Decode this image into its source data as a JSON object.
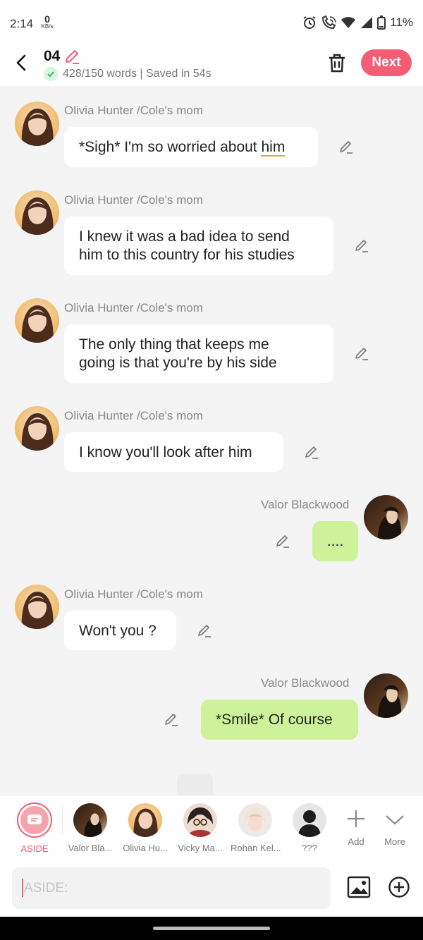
{
  "status_bar": {
    "time": "2:14",
    "net_speed_value": "0",
    "net_speed_unit": "KB/s",
    "battery": "11%",
    "icons": [
      "alarm-icon",
      "wifi-call-icon",
      "wifi-icon",
      "signal-icon",
      "battery-icon"
    ]
  },
  "header": {
    "title": "04",
    "subtitle": "428/150 words | Saved in 54s",
    "next_label": "Next"
  },
  "messages": [
    {
      "sender": "Olivia Hunter /Cole's mom",
      "text_pre": "*Sigh* I'm so worried about ",
      "text_underlined": "him",
      "mine": false
    },
    {
      "sender": "Olivia Hunter /Cole's mom",
      "line1": "I knew it was a bad idea to send",
      "line2": "him to this country for his studies",
      "mine": false
    },
    {
      "sender": "Olivia Hunter /Cole's mom",
      "line1": "The only thing that keeps me",
      "line2": "going is that you're by his side",
      "mine": false
    },
    {
      "sender": "Olivia Hunter /Cole's mom",
      "text": "I know you'll look after him",
      "mine": false
    },
    {
      "sender": "Valor Blackwood",
      "text": "....",
      "mine": true
    },
    {
      "sender": "Olivia Hunter /Cole's mom",
      "text": "Won't you ?",
      "mine": false
    },
    {
      "sender": "Valor Blackwood",
      "text": "*Smile* Of course",
      "mine": true
    }
  ],
  "characters": [
    {
      "label": "ASIDE",
      "active": true
    },
    {
      "label": "Valor Bla..."
    },
    {
      "label": "Olivia Hu..."
    },
    {
      "label": "Vicky Ma..."
    },
    {
      "label": "Rohan Kel..."
    },
    {
      "label": "???"
    },
    {
      "label": "Add"
    },
    {
      "label": "More"
    }
  ],
  "input": {
    "placeholder": "ASIDE:"
  },
  "colors": {
    "accent": "#f45d73",
    "my_bubble": "#cdf29a",
    "other_bubble": "#ffffff",
    "background": "#f4f4f4"
  }
}
